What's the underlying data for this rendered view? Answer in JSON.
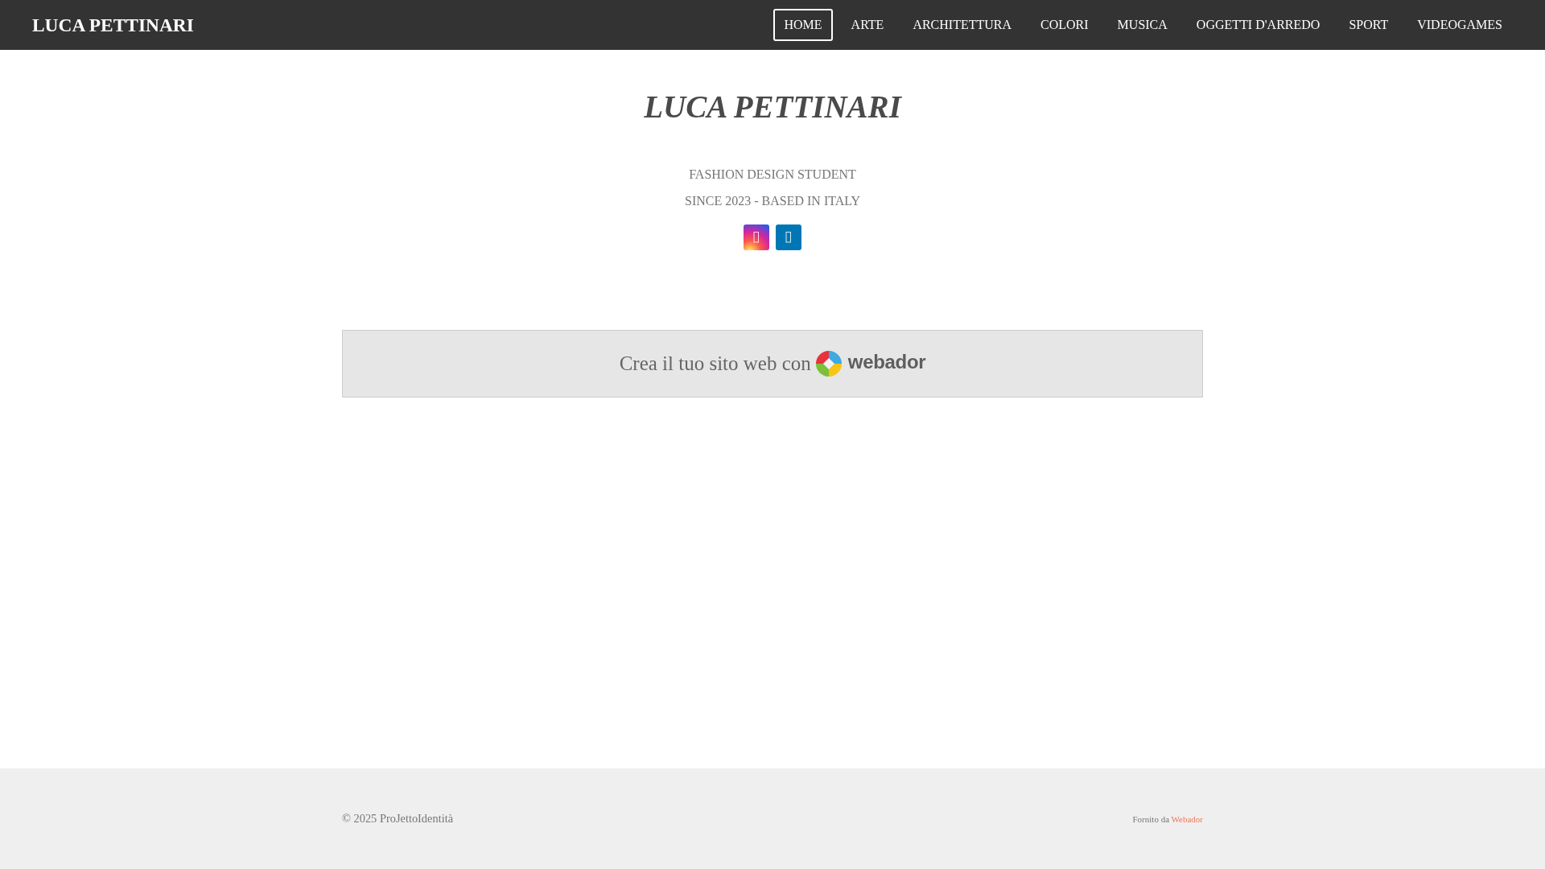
{
  "header": {
    "brand": "LUCA PETTINARI",
    "nav": [
      {
        "label": "HOME",
        "selected": true
      },
      {
        "label": "ARTE",
        "selected": false
      },
      {
        "label": "ARCHITETTURA",
        "selected": false
      },
      {
        "label": "COLORI",
        "selected": false
      },
      {
        "label": "MUSICA",
        "selected": false
      },
      {
        "label": "OGGETTI D'ARREDO",
        "selected": false
      },
      {
        "label": "SPORT",
        "selected": false
      },
      {
        "label": "VIDEOGAMES",
        "selected": false
      }
    ]
  },
  "hero": {
    "title": "LUCA PETTINARI",
    "lines": [
      "FASHION DESIGN STUDENT",
      "SINCE 2023 - BASED IN ITALY"
    ]
  },
  "banner": {
    "text": "Crea il tuo sito web con",
    "logo_text": "webador"
  },
  "footer": {
    "copyright": "© 2025 ProJettoIdentità",
    "credit": "Fornito da",
    "credit_link": "Webador"
  }
}
